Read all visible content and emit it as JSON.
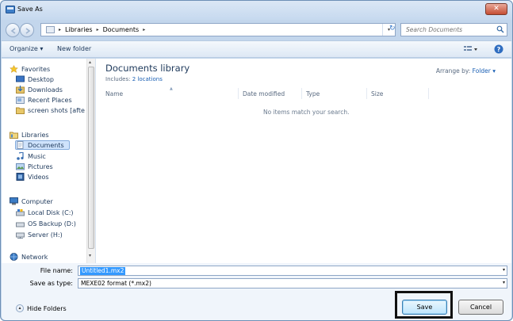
{
  "window": {
    "title": "Save As",
    "close_label": "✕"
  },
  "address": {
    "crumbs": [
      "Libraries",
      "Documents"
    ]
  },
  "search": {
    "placeholder": "Search Documents"
  },
  "toolbar": {
    "organize": "Organize ▾",
    "new_folder": "New folder"
  },
  "nav": {
    "items": [
      {
        "label": "Favorites",
        "icon": "star-icon"
      },
      {
        "label": "Desktop",
        "icon": "desktop-icon"
      },
      {
        "label": "Downloads",
        "icon": "downloads-icon"
      },
      {
        "label": "Recent Places",
        "icon": "recent-places-icon"
      },
      {
        "label": "screen shots [afte",
        "icon": "folder-icon"
      },
      {
        "label": "Libraries",
        "icon": "libraries-icon"
      },
      {
        "label": "Documents",
        "icon": "documents-icon",
        "selected": true
      },
      {
        "label": "Music",
        "icon": "music-icon"
      },
      {
        "label": "Pictures",
        "icon": "pictures-icon"
      },
      {
        "label": "Videos",
        "icon": "videos-icon"
      },
      {
        "label": "Computer",
        "icon": "computer-icon"
      },
      {
        "label": "Local Disk (C:)",
        "icon": "drive-icon"
      },
      {
        "label": "OS Backup (D:)",
        "icon": "drive-icon"
      },
      {
        "label": "Server (H:)",
        "icon": "network-drive-icon"
      },
      {
        "label": "Network",
        "icon": "network-icon"
      }
    ]
  },
  "content": {
    "library_title": "Documents library",
    "includes_label": "Includes:",
    "includes_link": "2 locations",
    "arrange_label": "Arrange by:",
    "arrange_value": "Folder ▾",
    "columns": [
      "Name",
      "Date modified",
      "Type",
      "Size"
    ],
    "empty_message": "No items match your search."
  },
  "fields": {
    "filename_label": "File name:",
    "filename_value": "Untitled1.mx2",
    "filetype_label": "Save as type:",
    "filetype_value": "MEXE02 format (*.mx2)"
  },
  "footer": {
    "hide_folders": "Hide Folders",
    "save": "Save",
    "cancel": "Cancel"
  }
}
